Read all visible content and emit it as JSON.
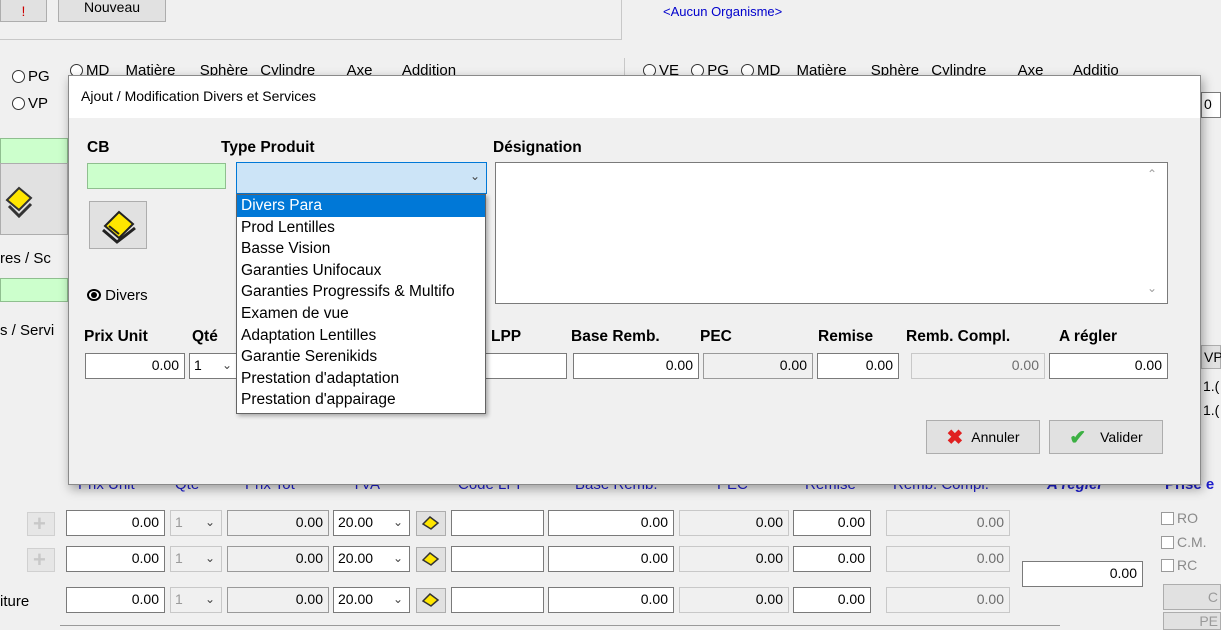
{
  "top": {
    "nouveau_label": "Nouveau",
    "organisme_text": "<Aucun Organisme>"
  },
  "left_panel": {
    "radio_pg": "PG",
    "radio_vp": "VP",
    "radio_md_partial": "MD",
    "col_headers": [
      "Matière",
      "Sphère",
      "Cylindre",
      "Axe",
      "Addition"
    ],
    "row_label_1": "res / Sc",
    "row_label_2": "s / Servi"
  },
  "right_panel": {
    "radio_labels": [
      "VE",
      "PG",
      "MD"
    ],
    "col_headers": [
      "Matière",
      "Sphère",
      "Cylindre",
      "Axe",
      "Additio"
    ],
    "side_value": "0",
    "side_vp": "VP",
    "side_trunc_1": "1.(",
    "side_trunc_2": "1.("
  },
  "dialog": {
    "title": "Ajout / Modification Divers et Services",
    "cb_label": "CB",
    "type_produit_label": "Type Produit",
    "designation_label": "Désignation",
    "divers_label": "Divers",
    "prix_unit_label": "Prix Unit",
    "qte_label": "Qté",
    "lpp_label": "LPP",
    "base_remb_label": "Base Remb.",
    "pec_label": "PEC",
    "remise_label": "Remise",
    "remb_compl_label": "Remb. Compl.",
    "a_regler_label": "A régler",
    "prix_unit_value": "0.00",
    "qte_value": "1",
    "base_remb_value": "0.00",
    "pec_value": "0.00",
    "remise_value": "0.00",
    "remb_compl_value": "0.00",
    "a_regler_value": "0.00",
    "annuler_label": "Annuler",
    "valider_label": "Valider",
    "dropdown_items": [
      "Divers Para",
      "Prod Lentilles",
      "Basse Vision",
      "Garanties Unifocaux",
      "Garanties Progressifs & Multifo",
      "Examen de vue",
      "Adaptation Lentilles",
      "Garantie Serenikids",
      "Prestation d'adaptation",
      "Prestation d'appairage"
    ]
  },
  "bottom": {
    "headers": [
      "Prix Unit",
      "Qté",
      "Prix Tot",
      "TVA",
      "Code LPP",
      "Base Remb.",
      "PEC",
      "Remise",
      "Remb. Compl.",
      "A régler",
      "Prise e"
    ],
    "rows": [
      {
        "label": "",
        "prix_unit": "0.00",
        "qte": "1",
        "prix_tot": "0.00",
        "tva": "20.00",
        "base_remb": "0.00",
        "pec": "0.00",
        "remise": "0.00",
        "remb_compl": "0.00"
      },
      {
        "label": "",
        "prix_unit": "0.00",
        "qte": "1",
        "prix_tot": "0.00",
        "tva": "20.00",
        "base_remb": "0.00",
        "pec": "0.00",
        "remise": "0.00",
        "remb_compl": "0.00"
      },
      {
        "label": "iture",
        "prix_unit": "0.00",
        "qte": "1",
        "prix_tot": "0.00",
        "tva": "20.00",
        "base_remb": "0.00",
        "pec": "0.00",
        "remise": "0.00",
        "remb_compl": "0.00"
      }
    ],
    "a_regler_total": "0.00",
    "checkboxes": [
      "RO",
      "C.M.",
      "RC"
    ],
    "side_btn_1": "C",
    "side_btn_2": "PE"
  }
}
